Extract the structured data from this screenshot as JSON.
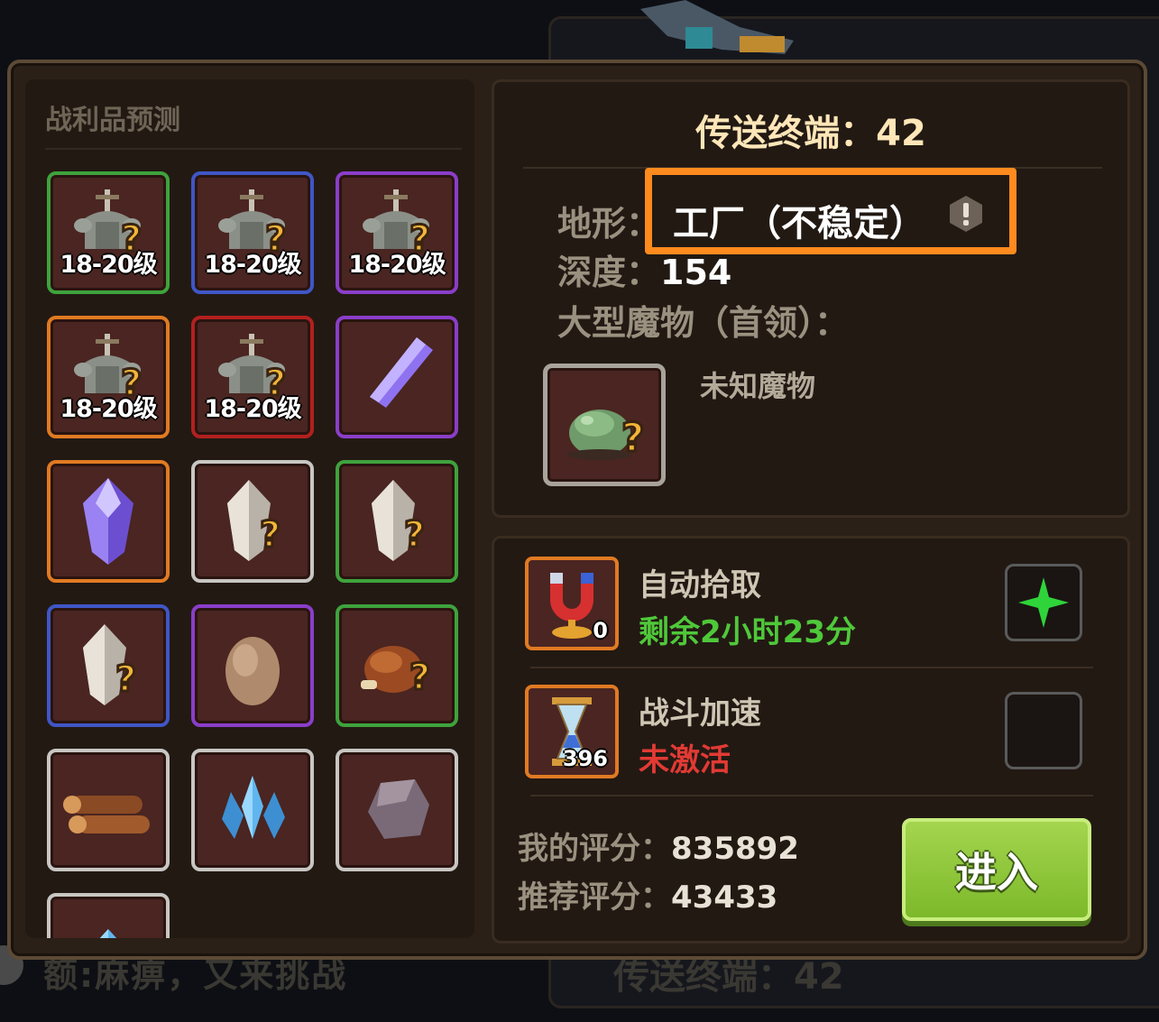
{
  "background": {
    "bottom_left_text": "额:麻痹，又来挑战",
    "bottom_right_text": "传送终端：42"
  },
  "loot": {
    "title": "战利品预测",
    "items": [
      {
        "name": "armor-mystery-icon",
        "level": "18-20级",
        "quality": "green"
      },
      {
        "name": "armor-mystery-icon",
        "level": "18-20级",
        "quality": "blue"
      },
      {
        "name": "armor-mystery-icon",
        "level": "18-20级",
        "quality": "purple"
      },
      {
        "name": "armor-mystery-icon",
        "level": "18-20级",
        "quality": "orange"
      },
      {
        "name": "armor-mystery-icon",
        "level": "18-20级",
        "quality": "red"
      },
      {
        "name": "purple-shard-icon",
        "level": "",
        "quality": "purple"
      },
      {
        "name": "purple-crystal-icon",
        "level": "",
        "quality": "orange"
      },
      {
        "name": "mystery-crystal-icon",
        "level": "",
        "quality": "white"
      },
      {
        "name": "mystery-crystal-icon",
        "level": "",
        "quality": "green"
      },
      {
        "name": "mystery-crystal-icon",
        "level": "",
        "quality": "blue"
      },
      {
        "name": "egg-icon",
        "level": "",
        "quality": "purple"
      },
      {
        "name": "roast-chicken-mystery-icon",
        "level": "",
        "quality": "green"
      },
      {
        "name": "wood-logs-icon",
        "level": "",
        "quality": "white"
      },
      {
        "name": "blue-crystal-cluster-icon",
        "level": "",
        "quality": "white"
      },
      {
        "name": "stone-ore-icon",
        "level": "",
        "quality": "white"
      },
      {
        "name": "blue-gem-icon",
        "level": "",
        "quality": "white"
      }
    ]
  },
  "portal": {
    "title": "传送终端：42",
    "terrain_label": "地形：",
    "terrain_value": "工厂（不稳定）",
    "depth_label": "深度：",
    "depth_value": "154",
    "boss_label": "大型魔物（首领）：",
    "boss_name": "未知魔物"
  },
  "buffs": [
    {
      "name": "自动拾取",
      "status": "剩余2小时23分",
      "status_type": "active",
      "count": "0",
      "icon": "magnet-icon",
      "button": "plus-icon"
    },
    {
      "name": "战斗加速",
      "status": "未激活",
      "status_type": "inactive",
      "count": "396",
      "icon": "hourglass-icon",
      "button": "checkbox"
    }
  ],
  "scores": {
    "my_label": "我的评分：",
    "my_value": "835892",
    "rec_label": "推荐评分：",
    "rec_value": "43433"
  },
  "enter_button": "进入",
  "colors": {
    "highlight": "#ff8a1e",
    "enter_green": "#8cc63a",
    "status_active": "#4fc83a",
    "status_inactive": "#e23a34"
  }
}
